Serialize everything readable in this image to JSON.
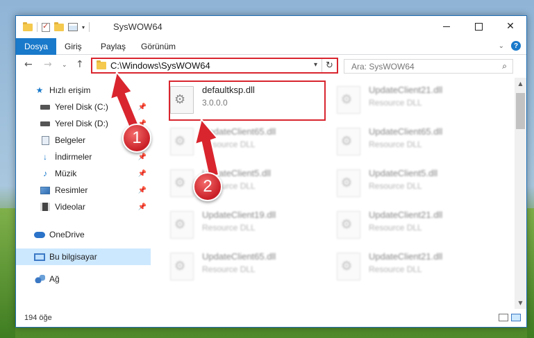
{
  "window": {
    "title": "SysWOW64"
  },
  "ribbon": {
    "tabs": [
      {
        "label": "Dosya"
      },
      {
        "label": "Giriş"
      },
      {
        "label": "Paylaş"
      },
      {
        "label": "Görünüm"
      }
    ]
  },
  "address": {
    "path": "C:\\Windows\\SysWOW64"
  },
  "search": {
    "placeholder": "Ara: SysWOW64"
  },
  "nav": {
    "items": [
      {
        "label": "Hızlı erişim",
        "icon": "star-icon",
        "pinned": false
      },
      {
        "label": "Yerel Disk (C:)",
        "icon": "drive-icon",
        "pinned": true
      },
      {
        "label": "Yerel Disk (D:)",
        "icon": "drive-icon",
        "pinned": true
      },
      {
        "label": "Belgeler",
        "icon": "documents-icon",
        "pinned": true
      },
      {
        "label": "İndirmeler",
        "icon": "download-icon",
        "pinned": true
      },
      {
        "label": "Müzik",
        "icon": "music-icon",
        "pinned": true
      },
      {
        "label": "Resimler",
        "icon": "pictures-icon",
        "pinned": true
      },
      {
        "label": "Videolar",
        "icon": "videos-icon",
        "pinned": true
      },
      {
        "label": "OneDrive",
        "icon": "onedrive-icon",
        "pinned": false
      },
      {
        "label": "Bu bilgisayar",
        "icon": "this-pc-icon",
        "pinned": false,
        "selected": true
      },
      {
        "label": "Ağ",
        "icon": "network-icon",
        "pinned": false
      }
    ]
  },
  "files": [
    {
      "name": "defaultksp.dll",
      "desc": "3.0.0.0",
      "highlighted": true
    },
    {
      "name": "UpdateClient21.dll",
      "desc": "Resource DLL"
    },
    {
      "name": "UpdateClient65.dll",
      "desc": "Resource DLL"
    },
    {
      "name": "UpdateClient65.dll",
      "desc": "Resource DLL"
    },
    {
      "name": "UpdateClient5.dll",
      "desc": "Resource DLL"
    },
    {
      "name": "UpdateClient5.dll",
      "desc": "Resource DLL"
    },
    {
      "name": "UpdateClient19.dll",
      "desc": "Resource DLL"
    },
    {
      "name": "UpdateClient21.dll",
      "desc": "Resource DLL"
    },
    {
      "name": "UpdateClient65.dll",
      "desc": "Resource DLL"
    },
    {
      "name": "UpdateClient21.dll",
      "desc": "Resource DLL"
    }
  ],
  "status": {
    "item_count": "194 öğe"
  },
  "annotations": {
    "marker1": "1",
    "marker2": "2",
    "color": "#d9252e"
  }
}
